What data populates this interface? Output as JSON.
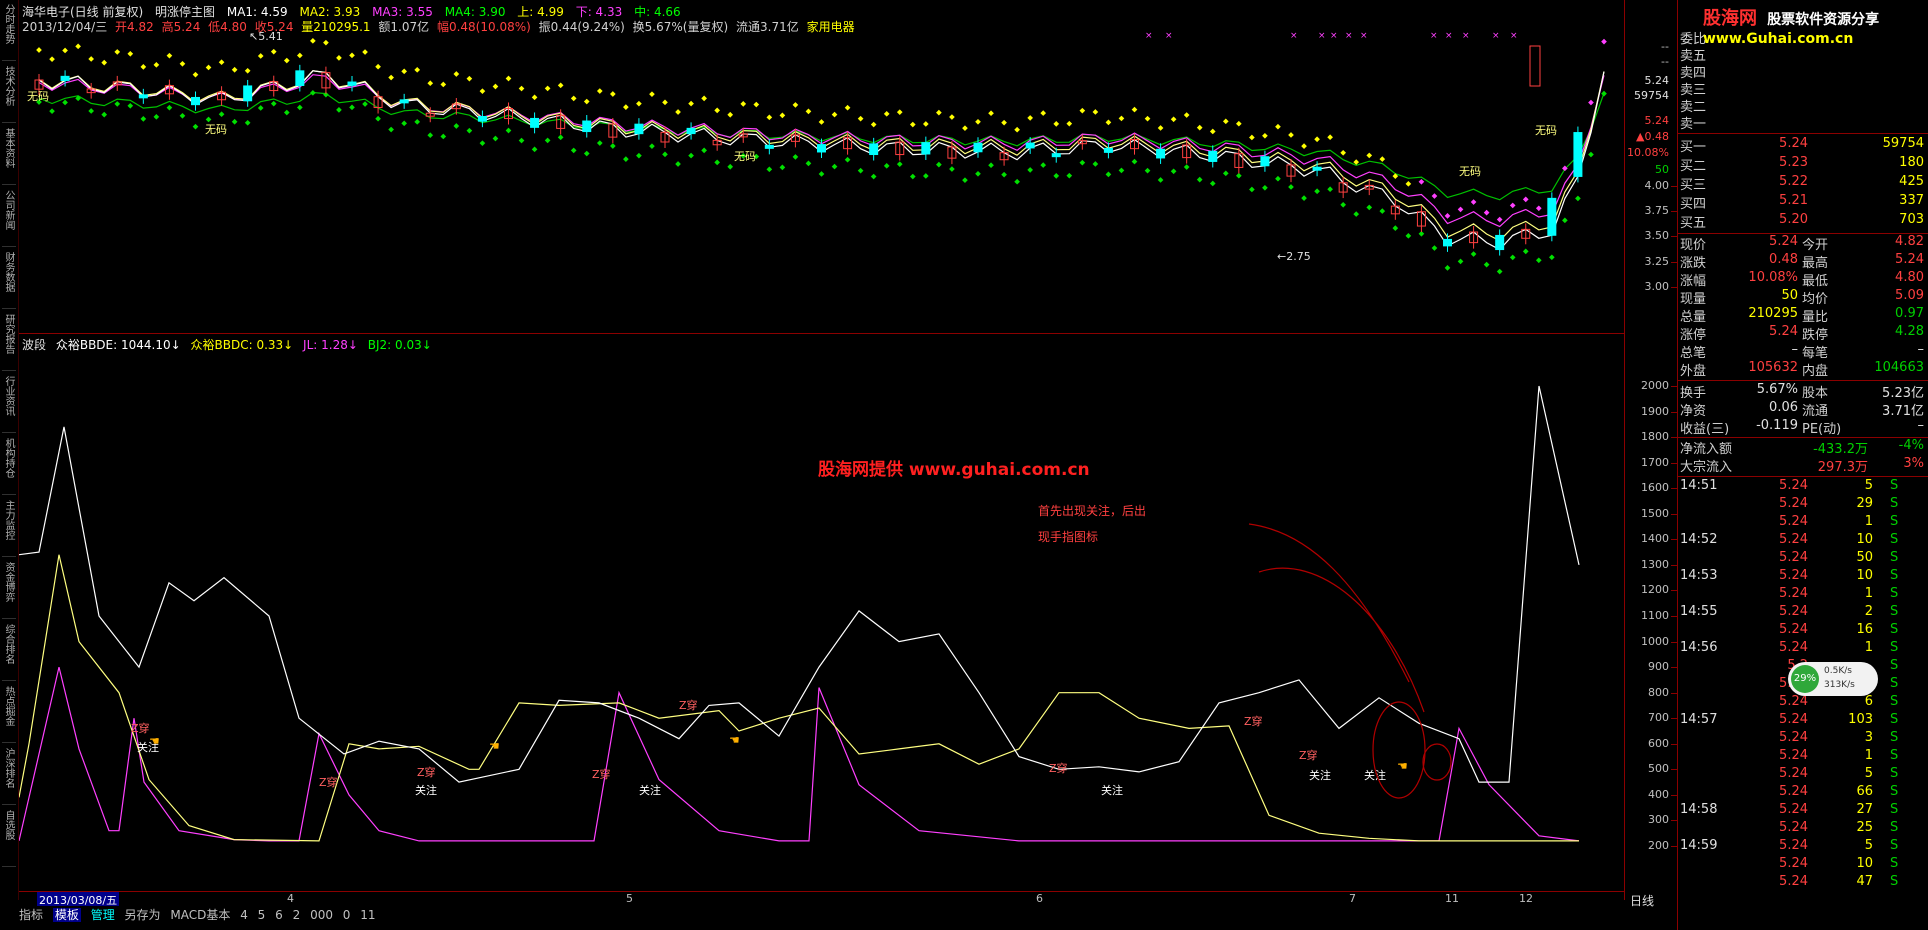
{
  "sidebar": {
    "tabs": [
      "分时走势",
      "技术分析",
      "基本资料",
      "公司新闻",
      "财务数据",
      "研究报告",
      "行业资讯",
      "机构持仓",
      "主力监控",
      "资金博弈",
      "综合排名",
      "热点掘金",
      "沪深排名",
      "自选股"
    ]
  },
  "header": {
    "title_line": [
      "海华电子(日线 前复权)",
      "明涨停主图",
      "MA1: 4.59",
      "MA2: 3.93",
      "MA3: 3.55",
      "MA4: 3.90",
      "上: 4.99",
      "下: 4.33",
      "中: 4.66"
    ],
    "quote_line": [
      "2013/12/04/三",
      "开4.82",
      "高5.24",
      "低4.80",
      "收5.24",
      "量210295.1",
      "额1.07亿",
      "幅0.48(10.08%)",
      "振0.44(9.24%)",
      "换5.67%(量复权)",
      "流通3.71亿",
      "家用电器"
    ]
  },
  "main_chart": {
    "high_label": "5.41",
    "low_label": "2.75",
    "marker_label": "无码",
    "y_ticks": [
      "4.00",
      "3.75",
      "3.50",
      "3.25",
      "3.00"
    ]
  },
  "indicator": {
    "header": [
      "波段",
      "众裕BBDE: 1044.10↓",
      "众裕BBDC: 0.33↓",
      "JL: 1.28↓",
      "BJ2: 0.03↓"
    ],
    "y_ticks": [
      "2000",
      "1900",
      "1800",
      "1700",
      "1600",
      "1500",
      "1400",
      "1300",
      "1200",
      "1100",
      "1000",
      "900",
      "800",
      "700",
      "600",
      "500",
      "400",
      "300",
      "200"
    ],
    "signal_z": "Z穿",
    "signal_gz": "关注"
  },
  "annotations": {
    "watermark": "股海网提供 www.guhai.com.cn",
    "note_line1": "首先出现关注，后出",
    "note_line2": "现手指图标"
  },
  "y_axis_panel": {
    "dashes": [
      "--",
      "--"
    ],
    "price": "5.24",
    "volume": "59754",
    "price2": "5.24",
    "change": "▲0.48",
    "pct": "10.08%",
    "small": "50"
  },
  "xaxis": {
    "date_badge": "2013/03/08/五",
    "labels": [
      "4",
      "5",
      "6",
      "7",
      "11",
      "12"
    ],
    "period": "日线"
  },
  "bottom_toolbar": [
    "指标",
    "模板",
    "管理",
    "另存为",
    "MACD基本",
    "4",
    "5",
    "6",
    "2",
    "000",
    "0",
    "11"
  ],
  "brand": {
    "name": "股海网",
    "slogan": "股票软件资源分享",
    "url": "www.Guhai.com.cn"
  },
  "orderbook": {
    "weibi_label": "委比",
    "sells": [
      {
        "label": "卖五",
        "price": "",
        "vol": ""
      },
      {
        "label": "卖四",
        "price": "",
        "vol": ""
      },
      {
        "label": "卖三",
        "price": "",
        "vol": ""
      },
      {
        "label": "卖二",
        "price": "",
        "vol": ""
      },
      {
        "label": "卖一",
        "price": "",
        "vol": ""
      }
    ],
    "buys": [
      {
        "label": "买一",
        "price": "5.24",
        "vol": "59754"
      },
      {
        "label": "买二",
        "price": "5.23",
        "vol": "180"
      },
      {
        "label": "买三",
        "price": "5.22",
        "vol": "425"
      },
      {
        "label": "买四",
        "price": "5.21",
        "vol": "337"
      },
      {
        "label": "买五",
        "price": "5.20",
        "vol": "703"
      }
    ]
  },
  "quote": [
    {
      "l1": "现价",
      "v1": "5.24",
      "c1": "red",
      "l2": "今开",
      "v2": "4.82",
      "c2": "red"
    },
    {
      "l1": "涨跌",
      "v1": "0.48",
      "c1": "red",
      "l2": "最高",
      "v2": "5.24",
      "c2": "red"
    },
    {
      "l1": "涨幅",
      "v1": "10.08%",
      "c1": "red",
      "l2": "最低",
      "v2": "4.80",
      "c2": "red"
    },
    {
      "l1": "现量",
      "v1": "50",
      "c1": "yellow",
      "l2": "均价",
      "v2": "5.09",
      "c2": "red"
    },
    {
      "l1": "总量",
      "v1": "210295",
      "c1": "yellow",
      "l2": "量比",
      "v2": "0.97",
      "c2": "green"
    },
    {
      "l1": "涨停",
      "v1": "5.24",
      "c1": "red",
      "l2": "跌停",
      "v2": "4.28",
      "c2": "green"
    },
    {
      "l1": "总笔",
      "v1": "–",
      "c1": "white",
      "l2": "每笔",
      "v2": "–",
      "c2": "white"
    },
    {
      "l1": "外盘",
      "v1": "105632",
      "c1": "red",
      "l2": "内盘",
      "v2": "104663",
      "c2": "green"
    }
  ],
  "fundamentals": [
    {
      "l1": "换手",
      "v1": "5.67%",
      "l2": "股本",
      "v2": "5.23亿"
    },
    {
      "l1": "净资",
      "v1": "0.06",
      "l2": "流通",
      "v2": "3.71亿"
    },
    {
      "l1": "收益(三)",
      "v1": "-0.119",
      "l2": "PE(动)",
      "v2": "–"
    }
  ],
  "flows": [
    {
      "label": "净流入额",
      "value": "-433.2万",
      "pct": "-4%",
      "color": "green"
    },
    {
      "label": "大宗流入",
      "value": "297.3万",
      "pct": "3%",
      "color": "red"
    }
  ],
  "ticks": [
    {
      "t": "14:51",
      "p": "5.24",
      "v": "5",
      "s": "S"
    },
    {
      "t": "",
      "p": "5.24",
      "v": "29",
      "s": "S"
    },
    {
      "t": "",
      "p": "5.24",
      "v": "1",
      "s": "S"
    },
    {
      "t": "14:52",
      "p": "5.24",
      "v": "10",
      "s": "S"
    },
    {
      "t": "",
      "p": "5.24",
      "v": "50",
      "s": "S"
    },
    {
      "t": "14:53",
      "p": "5.24",
      "v": "10",
      "s": "S"
    },
    {
      "t": "",
      "p": "5.24",
      "v": "1",
      "s": "S"
    },
    {
      "t": "14:55",
      "p": "5.24",
      "v": "2",
      "s": "S"
    },
    {
      "t": "",
      "p": "5.24",
      "v": "16",
      "s": "S"
    },
    {
      "t": "14:56",
      "p": "5.24",
      "v": "1",
      "s": "S"
    },
    {
      "t": "",
      "p": "5.2",
      "v": "",
      "s": "S"
    },
    {
      "t": "",
      "p": "5.24",
      "v": "41",
      "s": "S"
    },
    {
      "t": "",
      "p": "5.24",
      "v": "6",
      "s": "S"
    },
    {
      "t": "14:57",
      "p": "5.24",
      "v": "103",
      "s": "S"
    },
    {
      "t": "",
      "p": "5.24",
      "v": "3",
      "s": "S"
    },
    {
      "t": "",
      "p": "5.24",
      "v": "1",
      "s": "S"
    },
    {
      "t": "",
      "p": "5.24",
      "v": "5",
      "s": "S"
    },
    {
      "t": "",
      "p": "5.24",
      "v": "66",
      "s": "S"
    },
    {
      "t": "14:58",
      "p": "5.24",
      "v": "27",
      "s": "S"
    },
    {
      "t": "",
      "p": "5.24",
      "v": "25",
      "s": "S"
    },
    {
      "t": "14:59",
      "p": "5.24",
      "v": "5",
      "s": "S"
    },
    {
      "t": "",
      "p": "5.24",
      "v": "10",
      "s": "S"
    },
    {
      "t": "",
      "p": "5.24",
      "v": "47",
      "s": "S"
    }
  ],
  "netspeed": {
    "pct": "29%",
    "up": "0.5K/s",
    "down": "313K/s"
  }
}
